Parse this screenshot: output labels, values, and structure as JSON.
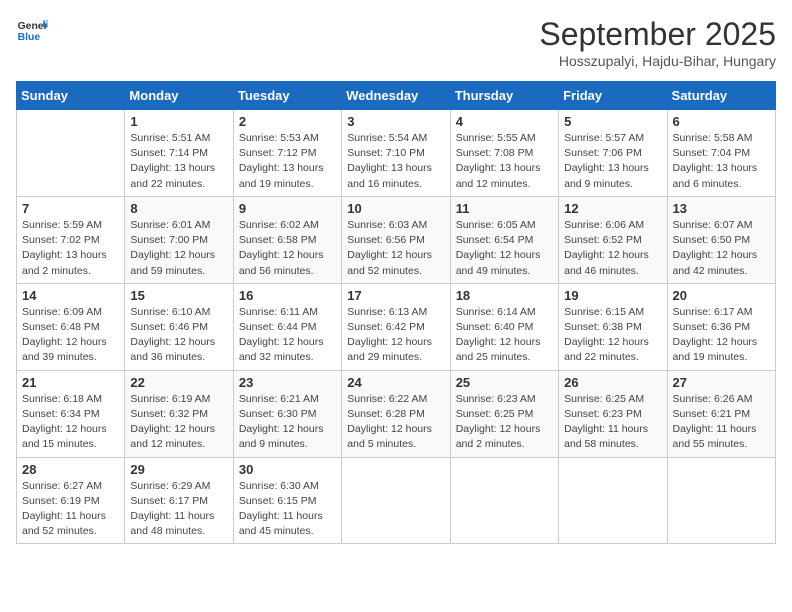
{
  "header": {
    "logo_line1": "General",
    "logo_line2": "Blue",
    "month": "September 2025",
    "location": "Hosszupalyi, Hajdu-Bihar, Hungary"
  },
  "days_of_week": [
    "Sunday",
    "Monday",
    "Tuesday",
    "Wednesday",
    "Thursday",
    "Friday",
    "Saturday"
  ],
  "weeks": [
    [
      {
        "day": "",
        "info": ""
      },
      {
        "day": "1",
        "info": "Sunrise: 5:51 AM\nSunset: 7:14 PM\nDaylight: 13 hours\nand 22 minutes."
      },
      {
        "day": "2",
        "info": "Sunrise: 5:53 AM\nSunset: 7:12 PM\nDaylight: 13 hours\nand 19 minutes."
      },
      {
        "day": "3",
        "info": "Sunrise: 5:54 AM\nSunset: 7:10 PM\nDaylight: 13 hours\nand 16 minutes."
      },
      {
        "day": "4",
        "info": "Sunrise: 5:55 AM\nSunset: 7:08 PM\nDaylight: 13 hours\nand 12 minutes."
      },
      {
        "day": "5",
        "info": "Sunrise: 5:57 AM\nSunset: 7:06 PM\nDaylight: 13 hours\nand 9 minutes."
      },
      {
        "day": "6",
        "info": "Sunrise: 5:58 AM\nSunset: 7:04 PM\nDaylight: 13 hours\nand 6 minutes."
      }
    ],
    [
      {
        "day": "7",
        "info": "Sunrise: 5:59 AM\nSunset: 7:02 PM\nDaylight: 13 hours\nand 2 minutes."
      },
      {
        "day": "8",
        "info": "Sunrise: 6:01 AM\nSunset: 7:00 PM\nDaylight: 12 hours\nand 59 minutes."
      },
      {
        "day": "9",
        "info": "Sunrise: 6:02 AM\nSunset: 6:58 PM\nDaylight: 12 hours\nand 56 minutes."
      },
      {
        "day": "10",
        "info": "Sunrise: 6:03 AM\nSunset: 6:56 PM\nDaylight: 12 hours\nand 52 minutes."
      },
      {
        "day": "11",
        "info": "Sunrise: 6:05 AM\nSunset: 6:54 PM\nDaylight: 12 hours\nand 49 minutes."
      },
      {
        "day": "12",
        "info": "Sunrise: 6:06 AM\nSunset: 6:52 PM\nDaylight: 12 hours\nand 46 minutes."
      },
      {
        "day": "13",
        "info": "Sunrise: 6:07 AM\nSunset: 6:50 PM\nDaylight: 12 hours\nand 42 minutes."
      }
    ],
    [
      {
        "day": "14",
        "info": "Sunrise: 6:09 AM\nSunset: 6:48 PM\nDaylight: 12 hours\nand 39 minutes."
      },
      {
        "day": "15",
        "info": "Sunrise: 6:10 AM\nSunset: 6:46 PM\nDaylight: 12 hours\nand 36 minutes."
      },
      {
        "day": "16",
        "info": "Sunrise: 6:11 AM\nSunset: 6:44 PM\nDaylight: 12 hours\nand 32 minutes."
      },
      {
        "day": "17",
        "info": "Sunrise: 6:13 AM\nSunset: 6:42 PM\nDaylight: 12 hours\nand 29 minutes."
      },
      {
        "day": "18",
        "info": "Sunrise: 6:14 AM\nSunset: 6:40 PM\nDaylight: 12 hours\nand 25 minutes."
      },
      {
        "day": "19",
        "info": "Sunrise: 6:15 AM\nSunset: 6:38 PM\nDaylight: 12 hours\nand 22 minutes."
      },
      {
        "day": "20",
        "info": "Sunrise: 6:17 AM\nSunset: 6:36 PM\nDaylight: 12 hours\nand 19 minutes."
      }
    ],
    [
      {
        "day": "21",
        "info": "Sunrise: 6:18 AM\nSunset: 6:34 PM\nDaylight: 12 hours\nand 15 minutes."
      },
      {
        "day": "22",
        "info": "Sunrise: 6:19 AM\nSunset: 6:32 PM\nDaylight: 12 hours\nand 12 minutes."
      },
      {
        "day": "23",
        "info": "Sunrise: 6:21 AM\nSunset: 6:30 PM\nDaylight: 12 hours\nand 9 minutes."
      },
      {
        "day": "24",
        "info": "Sunrise: 6:22 AM\nSunset: 6:28 PM\nDaylight: 12 hours\nand 5 minutes."
      },
      {
        "day": "25",
        "info": "Sunrise: 6:23 AM\nSunset: 6:25 PM\nDaylight: 12 hours\nand 2 minutes."
      },
      {
        "day": "26",
        "info": "Sunrise: 6:25 AM\nSunset: 6:23 PM\nDaylight: 11 hours\nand 58 minutes."
      },
      {
        "day": "27",
        "info": "Sunrise: 6:26 AM\nSunset: 6:21 PM\nDaylight: 11 hours\nand 55 minutes."
      }
    ],
    [
      {
        "day": "28",
        "info": "Sunrise: 6:27 AM\nSunset: 6:19 PM\nDaylight: 11 hours\nand 52 minutes."
      },
      {
        "day": "29",
        "info": "Sunrise: 6:29 AM\nSunset: 6:17 PM\nDaylight: 11 hours\nand 48 minutes."
      },
      {
        "day": "30",
        "info": "Sunrise: 6:30 AM\nSunset: 6:15 PM\nDaylight: 11 hours\nand 45 minutes."
      },
      {
        "day": "",
        "info": ""
      },
      {
        "day": "",
        "info": ""
      },
      {
        "day": "",
        "info": ""
      },
      {
        "day": "",
        "info": ""
      }
    ]
  ]
}
